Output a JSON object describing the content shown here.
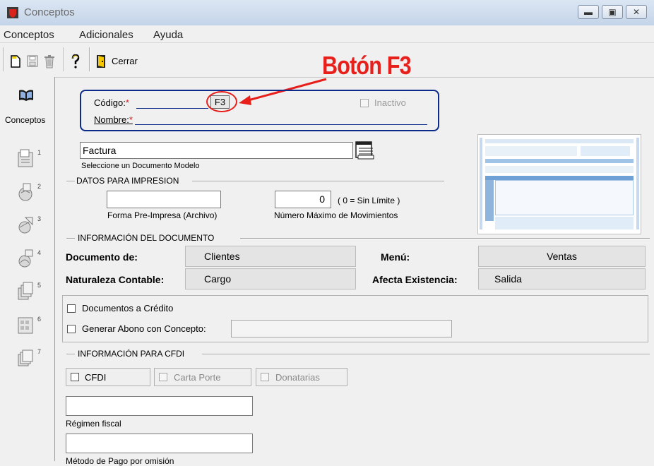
{
  "window": {
    "title": "Conceptos"
  },
  "menu": [
    "Conceptos",
    "Adicionales",
    "Ayuda"
  ],
  "toolbar": {
    "close_label": "Cerrar"
  },
  "sidebar": {
    "conceptos_label": "Conceptos",
    "nums": [
      "1",
      "2",
      "3",
      "4",
      "5",
      "6",
      "7"
    ]
  },
  "header": {
    "codigo_label": "Código:",
    "nombre_label": "Nombre:",
    "required_mark": "*",
    "f3_label": "F3",
    "inactivo_label": "Inactivo"
  },
  "annotation": {
    "text": "Botón F3",
    "color": "#e8201c"
  },
  "modelo": {
    "value": "Factura",
    "hint": "Seleccione un Documento Modelo"
  },
  "impresion": {
    "section": "DATOS PARA IMPRESION",
    "forma_label": "Forma Pre-Impresa (Archivo)",
    "max_value": "0",
    "max_note": "( 0 = Sin Límite )",
    "max_label": "Número Máximo de Movimientos"
  },
  "info_doc": {
    "section": "INFORMACIÓN  DEL DOCUMENTO",
    "documento_de_label": "Documento de:",
    "documento_de_value": "Clientes",
    "menu_label": "Menú:",
    "menu_value": "Ventas",
    "naturaleza_label": "Naturaleza Contable:",
    "naturaleza_value": "Cargo",
    "afecta_label": "Afecta Existencia:",
    "afecta_value": "Salida"
  },
  "credito": {
    "docs_credito": "Documentos a Crédito",
    "generar_abono": "Generar Abono con Concepto:"
  },
  "cfdi": {
    "section": "INFORMACIÓN PARA CFDI",
    "cfdi_label": "CFDI",
    "carta_porte_label": "Carta Porte",
    "donatarias_label": "Donatarias",
    "regimen_label": "Régimen fiscal",
    "metodo_label": "Método de Pago por omisión"
  },
  "colors": {
    "frame_blue": "#0b2a8a",
    "annotation_red": "#e8201c"
  }
}
